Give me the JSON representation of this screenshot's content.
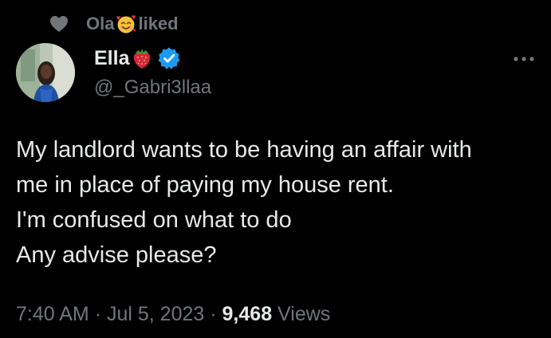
{
  "social_context": {
    "user": "Ola",
    "emoji": "smiling-face-with-hearts",
    "action": "liked"
  },
  "author": {
    "display_name": "Ella",
    "name_emoji": "strawberry",
    "verified": true,
    "handle": "@_Gabri3llaa",
    "verified_color": "#1d9bf0"
  },
  "tweet": {
    "lines": [
      "My landlord wants to be having an affair with",
      "me in place of paying my house rent.",
      "I'm confused on what to do",
      "Any advise please?"
    ]
  },
  "meta": {
    "time": "7:40 AM",
    "separator": "·",
    "date": "Jul 5, 2023",
    "views_count": "9,468",
    "views_label": "Views"
  },
  "colors": {
    "background": "#000000",
    "primary_text": "#e7e9ea",
    "secondary_text": "#71767b",
    "accent": "#1d9bf0"
  }
}
